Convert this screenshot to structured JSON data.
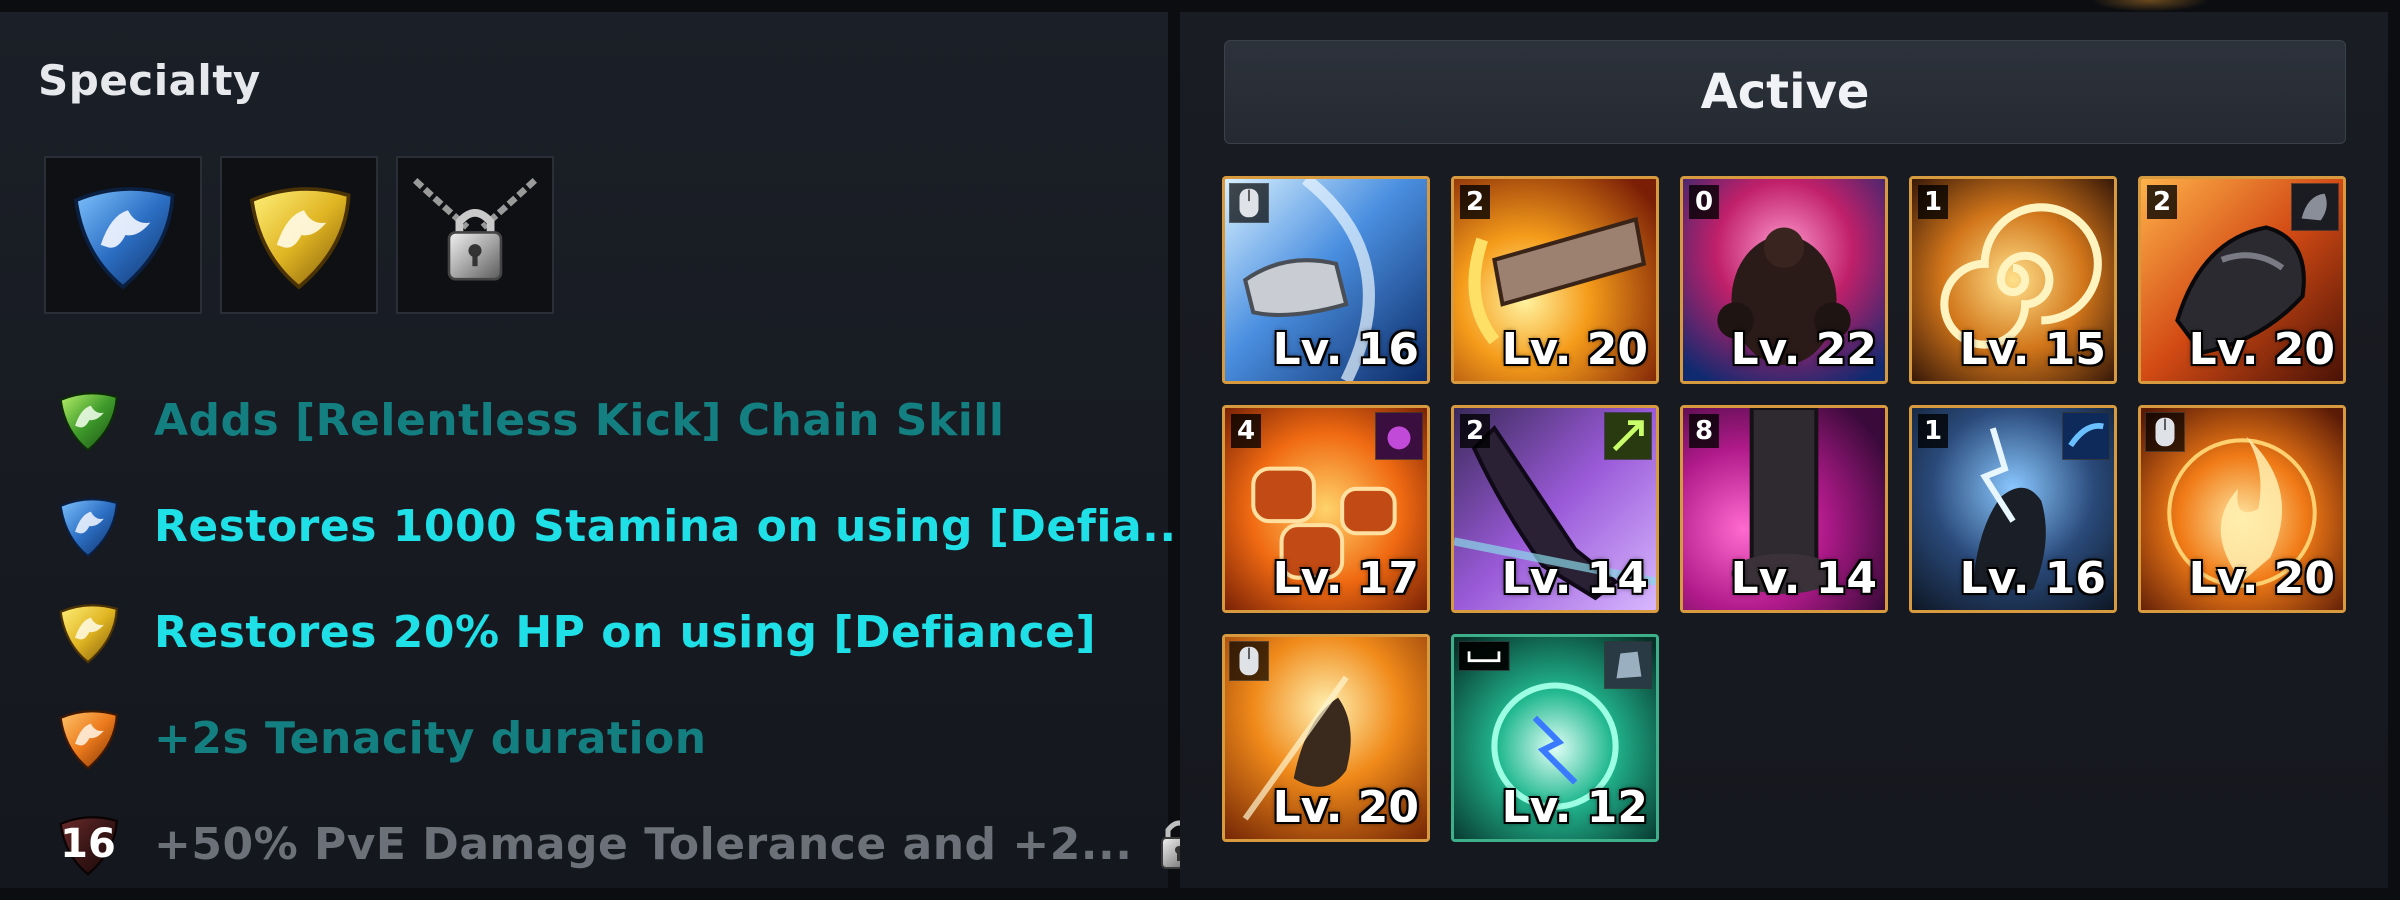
{
  "specialty": {
    "title": "Specialty",
    "slots": [
      {
        "icon": "blue-crest-icon",
        "locked": false
      },
      {
        "icon": "gold-crest-icon",
        "locked": false
      },
      {
        "icon": "padlock-chain-icon",
        "locked": true
      }
    ],
    "effects": [
      {
        "icon": "green-crest-icon",
        "text": "Adds [Relentless Kick] Chain Skill",
        "color": "#137f80"
      },
      {
        "icon": "blue-crest-icon",
        "text": "Restores 1000 Stamina on using [Defia...",
        "color": "#1ee0e6"
      },
      {
        "icon": "gold-crest-icon",
        "text": "Restores 20% HP on using [Defiance]",
        "color": "#1ee0e6"
      },
      {
        "icon": "orange-crest-icon",
        "text": "+2s Tenacity duration",
        "color": "#137f80"
      },
      {
        "icon": "dark-crest-icon",
        "badge": "16",
        "text": "+50% PvE Damage Tolerance and +2...",
        "color": "#6c7078",
        "locked": true
      }
    ]
  },
  "skills": {
    "tab_label": "Active",
    "items": [
      {
        "cost": "",
        "badge": "mouse-icon",
        "level": "Lv. 16",
        "art": "steel-gauntlet"
      },
      {
        "cost": "2",
        "badge": "",
        "level": "Lv. 20",
        "art": "flame-arm"
      },
      {
        "cost": "0",
        "badge": "",
        "level": "Lv. 22",
        "art": "fire-demon"
      },
      {
        "cost": "1",
        "badge": "",
        "level": "Lv. 15",
        "art": "fire-spiral"
      },
      {
        "cost": "2",
        "badge": "armor-badge",
        "level": "Lv. 20",
        "art": "armored-charge"
      },
      {
        "cost": "4",
        "badge": "purple-badge",
        "level": "Lv. 17",
        "art": "fire-fists"
      },
      {
        "cost": "2",
        "badge": "green-badge",
        "level": "Lv. 14",
        "art": "violet-kick"
      },
      {
        "cost": "8",
        "badge": "",
        "level": "Lv. 14",
        "art": "magenta-stomp"
      },
      {
        "cost": "1",
        "badge": "blue-badge",
        "level": "Lv. 16",
        "art": "lightning-fighter"
      },
      {
        "cost": "",
        "badge": "mouse-icon",
        "level": "Lv. 20",
        "art": "flame-circle"
      },
      {
        "cost": "",
        "badge": "mouse-icon",
        "level": "Lv. 20",
        "art": "flame-leap"
      },
      {
        "cost": "space-key-icon",
        "badge": "stone-badge",
        "level": "Lv. 12",
        "art": "teal-orb",
        "border": "teal"
      }
    ]
  }
}
